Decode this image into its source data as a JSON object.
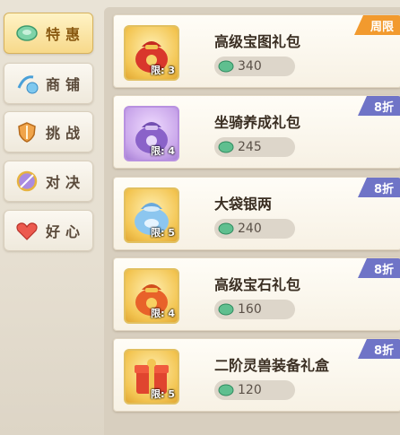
{
  "sidebar": {
    "tabs": [
      {
        "label": "特惠",
        "icon": "jade-coin-icon",
        "active": true
      },
      {
        "label": "商铺",
        "icon": "shop-icon",
        "active": false
      },
      {
        "label": "挑战",
        "icon": "shield-sword-icon",
        "active": false
      },
      {
        "label": "对决",
        "icon": "duel-icon",
        "active": false
      },
      {
        "label": "好心",
        "icon": "heart-icon",
        "active": false
      }
    ]
  },
  "packs": [
    {
      "title": "高级宝图礼包",
      "price": "340",
      "limit": "限: 3",
      "badge": "周限",
      "badge_color": "#f29a2e",
      "icon": "red-pouch-icon"
    },
    {
      "title": "坐骑养成礼包",
      "price": "245",
      "limit": "限: 4",
      "badge": "8折",
      "badge_color": "#6f74c7",
      "icon": "purple-pouch-icon"
    },
    {
      "title": "大袋银两",
      "price": "240",
      "limit": "限: 5",
      "badge": "8折",
      "badge_color": "#6f74c7",
      "icon": "silver-bag-icon"
    },
    {
      "title": "高级宝石礼包",
      "price": "160",
      "limit": "限: 4",
      "badge": "8折",
      "badge_color": "#6f74c7",
      "icon": "orange-pouch-icon"
    },
    {
      "title": "二阶灵兽装备礼盒",
      "price": "120",
      "limit": "限: 5",
      "badge": "8折",
      "badge_color": "#6f74c7",
      "icon": "gift-box-icon"
    }
  ],
  "colors": {
    "accent_orange": "#f29a2e",
    "accent_purple": "#6f74c7",
    "jade": "#5fbf8f"
  }
}
